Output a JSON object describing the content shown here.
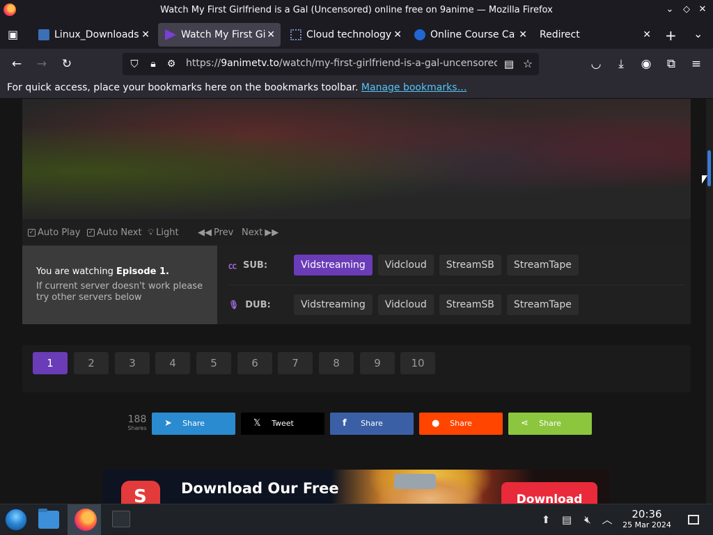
{
  "window": {
    "title": "Watch My First Girlfriend is a Gal (Uncensored) online free on 9anime — Mozilla Firefox",
    "minimize": "⌄",
    "maximize": "◇",
    "close": "✕"
  },
  "tabs": [
    {
      "label": "Linux_Downloads",
      "close": "✕"
    },
    {
      "label": "Watch My First Girlfriend",
      "close": "✕"
    },
    {
      "label": "Cloud technology",
      "close": "✕"
    },
    {
      "label": "Online Course Catalog",
      "close": "✕"
    },
    {
      "label": "Redirect",
      "close": "✕"
    }
  ],
  "tabbar": {
    "new_tab": "+",
    "list_all": "⌄",
    "view_icon": "▣"
  },
  "navbar": {
    "url_prefix": "https://",
    "url_host": "9animetv.to",
    "url_path": "/watch/my-first-girlfriend-is-a-gal-uncensored"
  },
  "bookmarks": {
    "text": "For quick access, place your bookmarks here on the bookmarks toolbar.",
    "link": "Manage bookmarks…"
  },
  "player_controls": {
    "auto_play": "Auto Play",
    "auto_next": "Auto Next",
    "light": "Light",
    "prev": "Prev",
    "next": "Next"
  },
  "servers": {
    "watching_prefix": "You are watching",
    "watching_episode": "Episode 1.",
    "note": "If current server doesn't work please try other servers below",
    "sub_label": "SUB:",
    "dub_label": "DUB:",
    "sub": [
      "Vidstreaming",
      "Vidcloud",
      "StreamSB",
      "StreamTape"
    ],
    "dub": [
      "Vidstreaming",
      "Vidcloud",
      "StreamSB",
      "StreamTape"
    ],
    "active_sub": "Vidstreaming"
  },
  "episodes": [
    "1",
    "2",
    "3",
    "4",
    "5",
    "6",
    "7",
    "8",
    "9",
    "10"
  ],
  "share": {
    "count": "188",
    "count_label": "Shares",
    "buttons": [
      {
        "label": "Share",
        "icon": "telegram-icon",
        "color": "#2a8bd0"
      },
      {
        "label": "Tweet",
        "icon": "x-icon",
        "color": "#000000"
      },
      {
        "label": "Share",
        "icon": "facebook-icon",
        "color": "#3b5fa5"
      },
      {
        "label": "Share",
        "icon": "reddit-icon",
        "color": "#ff4500"
      },
      {
        "label": "Share",
        "icon": "share-icon",
        "color": "#8cc63f"
      }
    ]
  },
  "banner": {
    "title": "Download Our Free",
    "button": "Download"
  },
  "taskbar": {
    "time": "20:36",
    "date": "25 Mar 2024"
  },
  "colors": {
    "accent": "#6a3cb7",
    "link": "#54c5f5"
  }
}
